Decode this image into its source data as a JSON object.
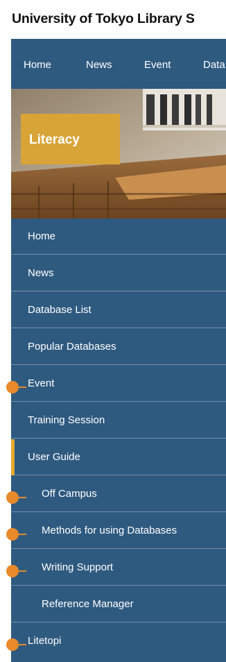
{
  "header": {
    "site_title": "University of Tokyo Library S"
  },
  "top_nav": {
    "items": [
      "Home",
      "News",
      "Event",
      "Data"
    ]
  },
  "hero": {
    "badge_label": "Literacy"
  },
  "side_menu": {
    "items": [
      {
        "label": "Home",
        "level": 0
      },
      {
        "label": "News",
        "level": 0
      },
      {
        "label": "Database List",
        "level": 0
      },
      {
        "label": "Popular Databases",
        "level": 0
      },
      {
        "label": "Event",
        "level": 0
      },
      {
        "label": "Training Session",
        "level": 0
      },
      {
        "label": "User Guide",
        "level": 0,
        "active": true
      },
      {
        "label": "Off Campus",
        "level": 1
      },
      {
        "label": "Methods for using Databases",
        "level": 1
      },
      {
        "label": "Writing Support",
        "level": 1
      },
      {
        "label": "Reference Manager",
        "level": 1
      },
      {
        "label": "Litetopi",
        "level": 0
      }
    ]
  },
  "colors": {
    "nav_blue": "#2f5a80",
    "badge_gold": "#d9a437",
    "active_accent": "#e7a72f",
    "callout_orange": "#e8892a"
  }
}
